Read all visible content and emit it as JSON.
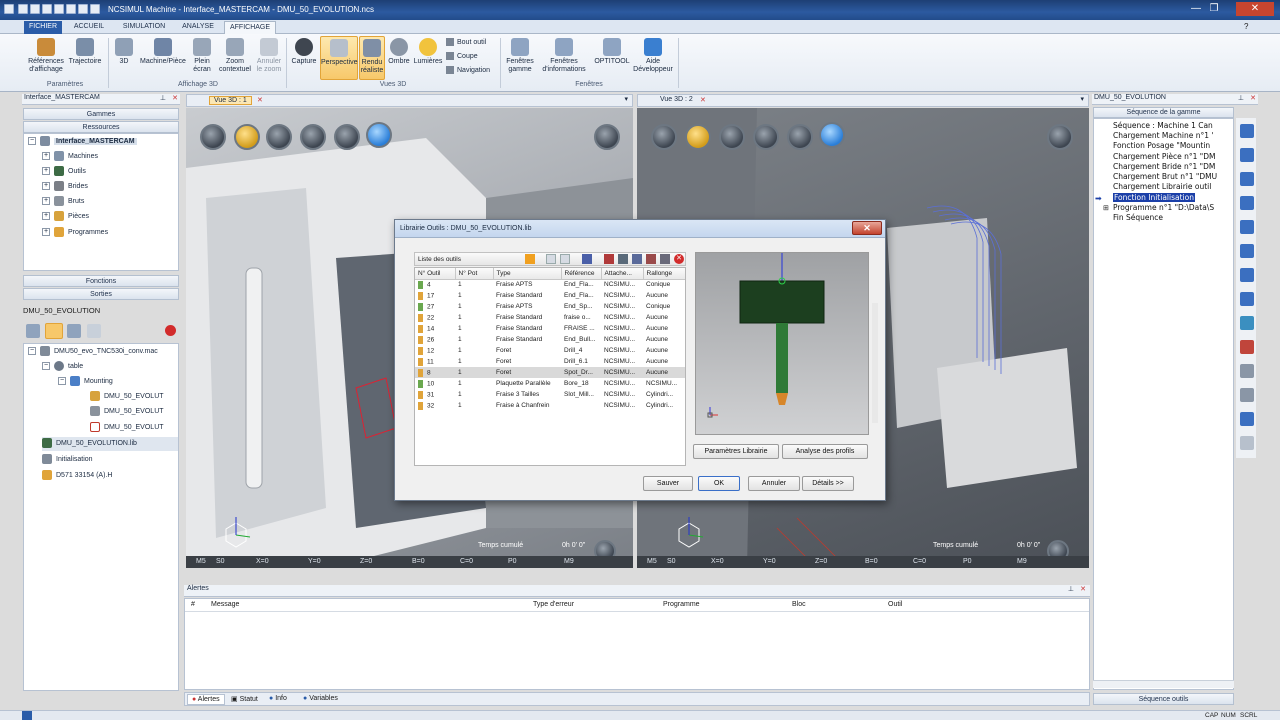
{
  "window": {
    "title": "NCSIMUL Machine - Interface_MASTERCAM - DMU_50_EVOLUTION.ncs",
    "minimize": "—",
    "maximize": "❐",
    "close": "✕"
  },
  "ribbon_tabs": [
    "FICHIER",
    "ACCUEIL",
    "SIMULATION",
    "ANALYSE",
    "AFFICHAGE"
  ],
  "ribbon": {
    "groups": {
      "parametres": "Paramètres",
      "affichage3d": "Affichage 3D",
      "vues3d": "Vues 3D",
      "fenetres": "Fenêtres"
    },
    "buttons": {
      "references": "Références d'affichage",
      "trajectoire": "Trajectoire",
      "b3d": "3D",
      "machine_piece": "Machine/Pièce",
      "plein_ecran": "Plein écran",
      "zoom_contextuel": "Zoom contextuel",
      "annuler_zoom": "Annuler le zoom",
      "capture": "Capture",
      "perspective": "Perspective",
      "rendu_realiste": "Rendu réaliste",
      "ombre": "Ombre",
      "lumieres": "Lumières",
      "bout_outil": "Bout outil",
      "coupe": "Coupe",
      "navigation": "Navigation",
      "fenetres_gamme": "Fenêtres gamme",
      "fenetres_info": "Fenêtres d'informations",
      "optitool": "OPTITOOL",
      "aide_dev": "Aide Développeur"
    }
  },
  "left_panel": {
    "header": "Interface_MASTERCAM",
    "sections": [
      "Gammes",
      "Ressources"
    ],
    "tree": [
      "Interface_MASTERCAM",
      "Machines",
      "Outils",
      "Brides",
      "Bruts",
      "Pièces",
      "Programmes"
    ],
    "sections2": [
      "Fonctions",
      "Sorties"
    ],
    "machine": "DMU_50_EVOLUTION",
    "tree2": [
      "DMU50_evo_TNC530i_conv.mac",
      "table",
      "Mounting",
      "DMU_50_EVOLUT",
      "DMU_50_EVOLUT",
      "DMU_50_EVOLUT",
      "DMU_50_EVOLUTION.lib",
      "Initialisation",
      "D571 33154 (A).H"
    ]
  },
  "viewports": {
    "left_title": "Vue 3D : 1",
    "right_title": "Vue 3D : 2",
    "temps_label": "Temps cumulé",
    "temps_value": "0h 0' 0\"",
    "axes_left": [
      "M5",
      "S0",
      "X=0",
      "Y=0",
      "Z=0",
      "B=0",
      "C=0",
      "P0",
      "M9"
    ],
    "axes_right": [
      "M5",
      "S0",
      "X=0",
      "Y=0",
      "Z=0",
      "B=0",
      "C=0",
      "P0",
      "M9"
    ]
  },
  "dialog": {
    "title": "Librairie Outils : DMU_50_EVOLUTION.lib",
    "list_label": "Liste des outils",
    "columns": [
      "N° Outil",
      "N° Pot",
      "Type",
      "Référence",
      "Attache...",
      "Rallonge"
    ],
    "rows": [
      [
        "4",
        "1",
        "Fraise APTS",
        "End_Fla...",
        "NCSIMU...",
        "Conique"
      ],
      [
        "17",
        "1",
        "Fraise Standard",
        "End_Fla...",
        "NCSIMU...",
        "Aucune"
      ],
      [
        "27",
        "1",
        "Fraise APTS",
        "End_Sp...",
        "NCSIMU...",
        "Conique"
      ],
      [
        "22",
        "1",
        "Fraise Standard",
        "fraise o...",
        "NCSIMU...",
        "Aucune"
      ],
      [
        "14",
        "1",
        "Fraise Standard",
        "FRAISE ...",
        "NCSIMU...",
        "Aucune"
      ],
      [
        "26",
        "1",
        "Fraise Standard",
        "End_Bull...",
        "NCSIMU...",
        "Aucune"
      ],
      [
        "12",
        "1",
        "Foret",
        "Drill_4",
        "NCSIMU...",
        "Aucune"
      ],
      [
        "11",
        "1",
        "Foret",
        "Drill_6.1",
        "NCSIMU...",
        "Aucune"
      ],
      [
        "8",
        "1",
        "Foret",
        "Spot_Dr...",
        "NCSIMU...",
        "Aucune"
      ],
      [
        "10",
        "1",
        "Plaquette Parallèle",
        "Bore_18",
        "NCSIMU...",
        "NCSIMU..."
      ],
      [
        "31",
        "1",
        "Fraise 3 Tailles",
        "Slot_Mill...",
        "NCSIMU...",
        "Cylindri..."
      ],
      [
        "32",
        "1",
        "Fraise à Chanfrein",
        "",
        "NCSIMU...",
        "Cylindri..."
      ]
    ],
    "selected_index": 8,
    "btn_params": "Paramètres Librairie",
    "btn_analyse": "Analyse des profils",
    "btn_sauver": "Sauver",
    "btn_ok": "OK",
    "btn_annuler": "Annuler",
    "btn_details": "Détails >>"
  },
  "alerts": {
    "header": "Alertes",
    "columns": [
      "#",
      "Message",
      "Type d'erreur",
      "Programme",
      "Bloc",
      "Outil"
    ],
    "tabs": [
      "Alertes",
      "Statut",
      "Info",
      "Variables"
    ]
  },
  "right_panel": {
    "header": "DMU_50_EVOLUTION",
    "section": "Séquence de la gamme",
    "sequence": [
      "Séquence : Machine 1 Can",
      "Chargement Machine n°1 '",
      "Fonction Posage \"Mountin",
      "Chargement Pièce n°1 \"DM",
      "Chargement Bride n°1 \"DM",
      "Chargement Brut n°1 \"DMU",
      "Chargement Librairie outil",
      "Fonction Initialisation",
      "Programme n°1 \"D:\\Data\\S",
      "Fin Séquence"
    ],
    "footer": "Séquence outils"
  },
  "statusbar": [
    "CAP",
    "NUM",
    "SCRL"
  ],
  "colors": {
    "title_blue": "#2c5aa0",
    "selection_blue": "#1b3fa8",
    "tool_green": "#1f6b2d",
    "highlight_orange": "#f7c86a"
  }
}
